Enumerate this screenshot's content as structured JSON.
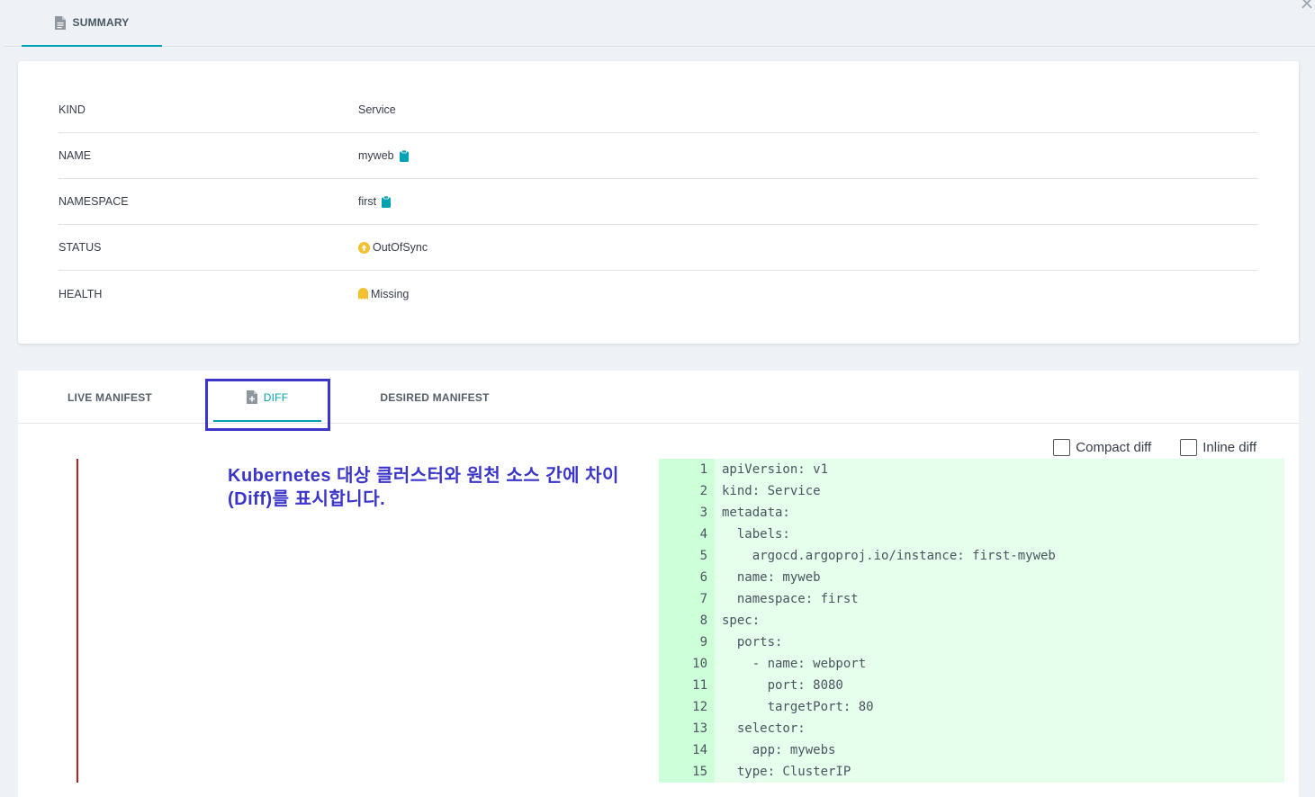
{
  "top_tab": {
    "label": "SUMMARY",
    "icon": "document-icon"
  },
  "summary": {
    "rows": [
      {
        "key": "KIND",
        "value": "Service"
      },
      {
        "key": "NAME",
        "value": "myweb"
      },
      {
        "key": "NAMESPACE",
        "value": "first"
      },
      {
        "key": "STATUS",
        "value": "OutOfSync"
      },
      {
        "key": "HEALTH",
        "value": "Missing"
      }
    ]
  },
  "colors": {
    "accent": "#00a2b3",
    "status_out_of_sync": "#f4c030",
    "health_missing": "#f4c030",
    "annotation": "#3b35c9",
    "diff_added_bg": "#e6ffed"
  },
  "diff_tabs": {
    "live": "LIVE MANIFEST",
    "diff": "DIFF",
    "desired": "DESIRED MANIFEST"
  },
  "options": {
    "compact": "Compact diff",
    "inline": "Inline diff"
  },
  "annotation": "Kubernetes 대상 클러스터와 원천 소스 간에 차이(Diff)를 표시합니다.",
  "code": [
    {
      "n": "1",
      "t": "apiVersion: v1"
    },
    {
      "n": "2",
      "t": "kind: Service"
    },
    {
      "n": "3",
      "t": "metadata:"
    },
    {
      "n": "4",
      "t": "  labels:"
    },
    {
      "n": "5",
      "t": "    argocd.argoproj.io/instance: first-myweb"
    },
    {
      "n": "6",
      "t": "  name: myweb"
    },
    {
      "n": "7",
      "t": "  namespace: first"
    },
    {
      "n": "8",
      "t": "spec:"
    },
    {
      "n": "9",
      "t": "  ports:"
    },
    {
      "n": "10",
      "t": "    - name: webport"
    },
    {
      "n": "11",
      "t": "      port: 8080"
    },
    {
      "n": "12",
      "t": "      targetPort: 80"
    },
    {
      "n": "13",
      "t": "  selector:"
    },
    {
      "n": "14",
      "t": "    app: mywebs"
    },
    {
      "n": "15",
      "t": "  type: ClusterIP"
    }
  ]
}
